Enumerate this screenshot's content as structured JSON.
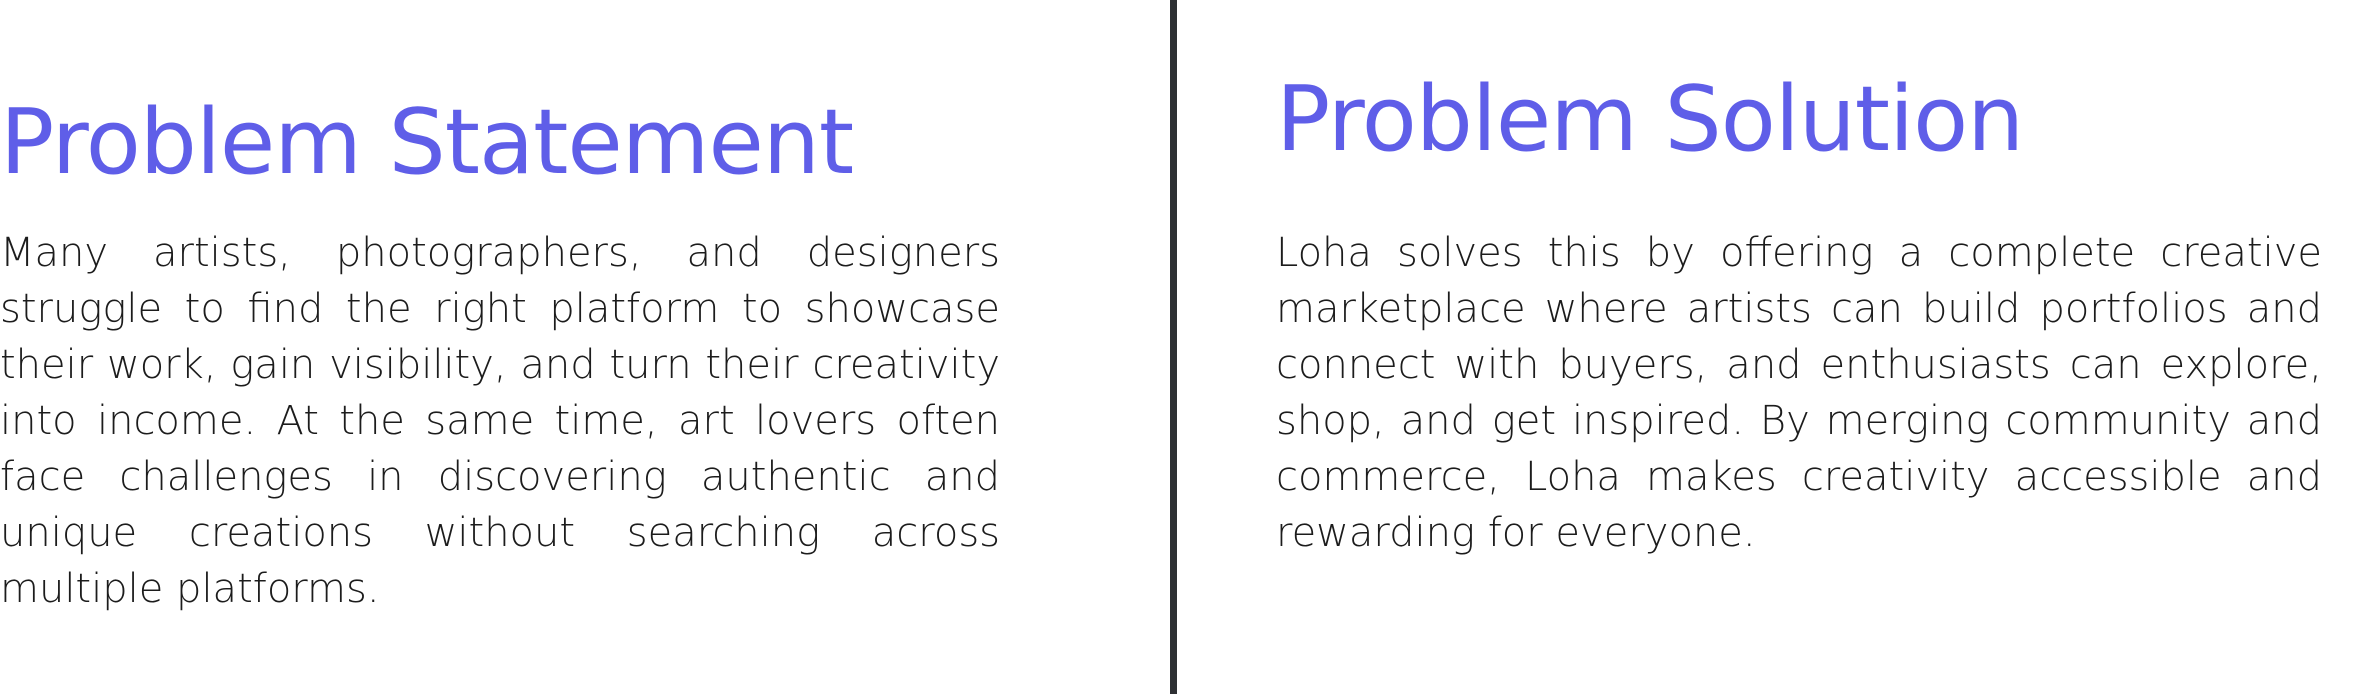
{
  "problem_statement": {
    "title": "Problem Statement",
    "body": "Many artists, photographers, and designers struggle to find the right platform to showcase their work, gain visibility, and turn their creativity into income. At the same time, art lovers often face challenges in discovering authentic and unique creations without searching across multiple platforms."
  },
  "problem_solution": {
    "title": "Problem Solution",
    "body": "Loha solves this by offering a complete creative marketplace where artists can build portfolios and connect with buyers, and enthusiasts can explore, shop, and get inspired. By merging community and commerce, Loha makes creativity accessible and rewarding for everyone."
  },
  "colors": {
    "heading": "#5f5ee8",
    "text": "#1c1c1c",
    "divider": "#2e3033",
    "background": "#ffffff"
  }
}
